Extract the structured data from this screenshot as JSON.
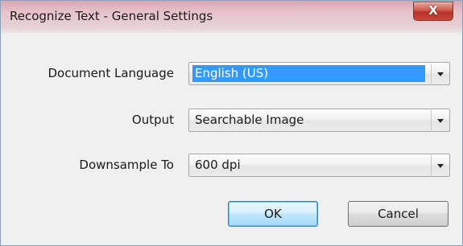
{
  "window": {
    "title": "Recognize Text - General Settings",
    "close_symbol": "X"
  },
  "form": {
    "document_language": {
      "label": "Document Language",
      "value": "English (US)"
    },
    "output": {
      "label": "Output",
      "value": "Searchable Image"
    },
    "downsample": {
      "label": "Downsample To",
      "value": "600 dpi"
    }
  },
  "buttons": {
    "ok": "OK",
    "cancel": "Cancel"
  },
  "colors": {
    "selection": "#3399ff",
    "close_button": "#c8463a"
  },
  "icons": {
    "close": "close-icon",
    "dropdown": "chevron-down-icon"
  }
}
